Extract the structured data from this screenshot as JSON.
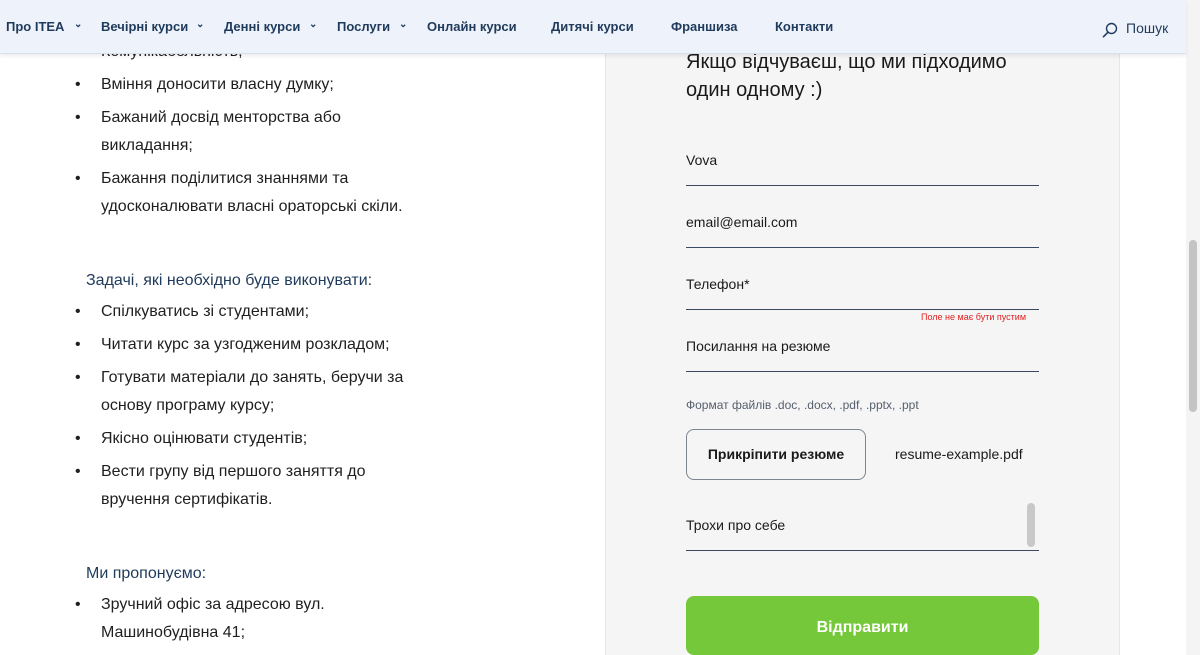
{
  "nav": {
    "items": [
      {
        "label": "Про ITEA",
        "dropdown": true
      },
      {
        "label": "Вечірні курси",
        "dropdown": true
      },
      {
        "label": "Денні курси",
        "dropdown": true
      },
      {
        "label": "Послуги",
        "dropdown": true
      },
      {
        "label": "Онлайн курси",
        "dropdown": false
      },
      {
        "label": "Дитячі курси",
        "dropdown": false
      },
      {
        "label": "Франшиза",
        "dropdown": false
      },
      {
        "label": "Контакти",
        "dropdown": false
      }
    ],
    "search_label": "Пошук",
    "search_icon": "search-icon"
  },
  "content": {
    "requirements_items": [
      "Комунікабельність;",
      "Вміння доносити власну думку;",
      "Бажаний досвід менторства або викладання;",
      "Бажання поділитися знаннями та удосконалювати власні ораторські скіли."
    ],
    "tasks_heading": "Задачі, які необхідно буде виконувати:",
    "tasks_items": [
      "Спілкуватись зі студентами;",
      "Читати курс за узгодженим розкладом;",
      "Готувати матеріали до занять, беручи за основу програму курсу;",
      "Якісно оцінювати студентів;",
      "Вести групу від першого заняття до вручення сертифікатів."
    ],
    "offer_heading": "Ми пропонуємо:",
    "offer_items": [
      "Зручний офіс за адресою вул. Машинобудівна 41;"
    ]
  },
  "form": {
    "title": "Якщо відчуваєш, що ми підходимо один одному :)",
    "name_value": "Vova",
    "email_value": "email@email.com",
    "phone_placeholder": "Телефон*",
    "phone_error": "Поле не має бути пустим",
    "resume_link_placeholder": "Посилання на резюме",
    "file_formats_hint": "Формат файлів .doc, .docx, .pdf, .pptx, .ppt",
    "attach_button": "Прикріпити резюме",
    "attached_file": "resume-example.pdf",
    "about_placeholder": "Трохи про себе",
    "submit_button": "Відправити"
  },
  "colors": {
    "nav_bg": "#eef3fb",
    "nav_text": "#1f3a5a",
    "panel_bg": "#f5f5f5",
    "submit_bg": "#74c83a",
    "error": "#e32121"
  }
}
